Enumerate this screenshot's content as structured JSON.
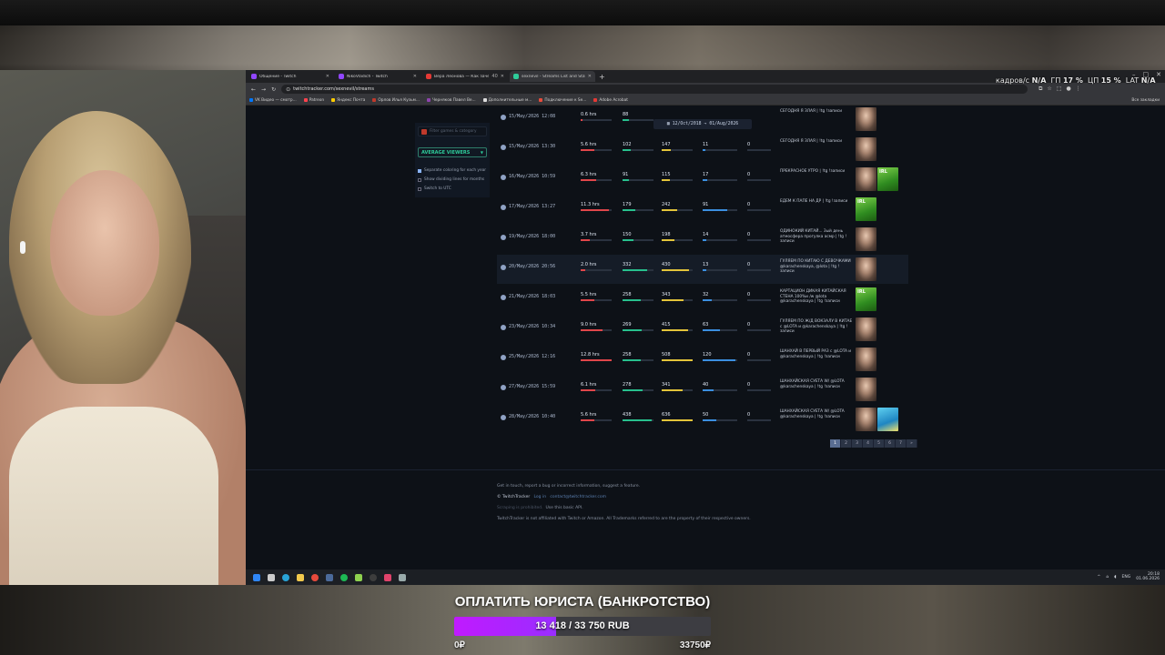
{
  "browser": {
    "tabs": [
      {
        "title": "Общение - Twitch",
        "color": "#9146ff"
      },
      {
        "title": "NikoVladich - Twitch",
        "color": "#9146ff"
      },
      {
        "title": "Вера Леонова — Как зачем?",
        "color": "#e53935"
      },
      {
        "title": "sexnevil - Streams List and Stat",
        "color": "#2ecc9a"
      }
    ],
    "tab_count_badge": "40",
    "url": "twitchtracker.com/sexnevil/streams",
    "bookmarks": [
      {
        "label": "VK Видео — смотр...",
        "color": "#0077ff"
      },
      {
        "label": "Patreon",
        "color": "#ff424d"
      },
      {
        "label": "Яндекс Почта",
        "color": "#ffcc00"
      },
      {
        "label": "Орлов Илья Кузьм...",
        "color": "#c0392b"
      },
      {
        "label": "Черняков Павел Ве...",
        "color": "#8e44ad"
      },
      {
        "label": "Дополнительные м...",
        "color": "#dddddd"
      },
      {
        "label": "Подключение к Se...",
        "color": "#e74c3c"
      },
      {
        "label": "Adobe Acrobat",
        "color": "#e53935"
      }
    ],
    "bookmarks_right": "Все закладки"
  },
  "sidebar": {
    "search_placeholder": "Filter games & category",
    "metric_select": "AVERAGE VIEWERS",
    "options": [
      {
        "label": "Separate coloring for each year",
        "checked": true
      },
      {
        "label": "Show dividing lines for months",
        "checked": false
      },
      {
        "label": "Switch to UTC",
        "checked": false
      }
    ]
  },
  "date_range": {
    "from": "12/Oct/2018",
    "arrow": "→",
    "to": "01/Aug/2026"
  },
  "streams": [
    {
      "date": "15/May/2026 12:08",
      "duration": "0.6 hrs",
      "avg": "88",
      "max": "",
      "followers": "",
      "views": "",
      "title": "СЕГОДНЯ Я ЗЛАЯ | !tg !записи",
      "thumbs": [
        "person"
      ],
      "dur_frac": 0.05,
      "avg_frac": 0.2,
      "max_frac": 0,
      "fol_frac": 0
    },
    {
      "date": "15/May/2026 13:30",
      "duration": "5.6 hrs",
      "avg": "102",
      "max": "147",
      "followers": "11",
      "views": "0",
      "title": "СЕГОДНЯ Я ЗЛАЯ | !tg !записи",
      "thumbs": [
        "person"
      ],
      "dur_frac": 0.45,
      "avg_frac": 0.25,
      "max_frac": 0.3,
      "fol_frac": 0.08
    },
    {
      "date": "16/May/2026 10:59",
      "duration": "6.3 hrs",
      "avg": "91",
      "max": "115",
      "followers": "17",
      "views": "0",
      "title": "ПРЕКРАСНОЕ УТРО | !tg !записи",
      "thumbs": [
        "person",
        "grass"
      ],
      "dur_frac": 0.5,
      "avg_frac": 0.22,
      "max_frac": 0.25,
      "fol_frac": 0.12
    },
    {
      "date": "17/May/2026 13:27",
      "duration": "11.3 hrs",
      "avg": "179",
      "max": "242",
      "followers": "91",
      "views": "0",
      "title": "ЕДЕМ К ПАПЕ НА ДР | !tg !записи",
      "thumbs": [
        "grass"
      ],
      "dur_frac": 0.9,
      "avg_frac": 0.42,
      "max_frac": 0.5,
      "fol_frac": 0.7
    },
    {
      "date": "19/May/2026 18:00",
      "duration": "3.7 hrs",
      "avg": "150",
      "max": "198",
      "followers": "14",
      "views": "0",
      "title": "ОДИНОКИЙ КИТАЙ... 3ый день атмосфера прогулка асмр | !tg !записи",
      "thumbs": [
        "person"
      ],
      "dur_frac": 0.3,
      "avg_frac": 0.35,
      "max_frac": 0.42,
      "fol_frac": 0.1
    },
    {
      "date": "20/May/2026 20:56",
      "duration": "2.0 hrs",
      "avg": "332",
      "max": "430",
      "followers": "13",
      "views": "0",
      "title": "ГУЛЯЕМ ПО КИТАЮ С ДЕВОЧКАМИ @karachenskaya, @lota | !tg !записи",
      "thumbs": [
        "person"
      ],
      "dur_frac": 0.16,
      "avg_frac": 0.78,
      "max_frac": 0.88,
      "fol_frac": 0.1
    },
    {
      "date": "21/May/2026 18:03",
      "duration": "5.5 hrs",
      "avg": "258",
      "max": "343",
      "followers": "32",
      "views": "0",
      "title": "КАРТАЦИОН ДИКАЯ КИТАЙСКАЯ СТЕНА 100%и /w @lota @karachenskaya | !tg !записи",
      "thumbs": [
        "grass"
      ],
      "dur_frac": 0.44,
      "avg_frac": 0.6,
      "max_frac": 0.7,
      "fol_frac": 0.25
    },
    {
      "date": "23/May/2026 10:34",
      "duration": "9.0 hrs",
      "avg": "269",
      "max": "415",
      "followers": "63",
      "views": "0",
      "title": "ГУЛЯЕМ ПО Ж/Д ВОКЗАЛУ В КИТАЕ c @LOTA и @karachenskaya | !tg !записи",
      "thumbs": [
        "person"
      ],
      "dur_frac": 0.72,
      "avg_frac": 0.62,
      "max_frac": 0.85,
      "fol_frac": 0.5
    },
    {
      "date": "25/May/2026 12:16",
      "duration": "12.8 hrs",
      "avg": "258",
      "max": "508",
      "followers": "120",
      "views": "0",
      "title": "ШАНХАЙ В ПЕРВЫЙ РАЗ с @LOTA и @karachenskaya | !tg !записи",
      "thumbs": [
        "person"
      ],
      "dur_frac": 1.0,
      "avg_frac": 0.6,
      "max_frac": 1.0,
      "fol_frac": 0.95
    },
    {
      "date": "27/May/2026 15:59",
      "duration": "6.1 hrs",
      "avg": "278",
      "max": "341",
      "followers": "40",
      "views": "0",
      "title": "ШАНХАЙСКАЯ СУЕТА W/ @LOTA @karachenskaya | !tg !записи",
      "thumbs": [
        "person"
      ],
      "dur_frac": 0.48,
      "avg_frac": 0.64,
      "max_frac": 0.68,
      "fol_frac": 0.32
    },
    {
      "date": "28/May/2026 10:40",
      "duration": "5.6 hrs",
      "avg": "438",
      "max": "636",
      "followers": "50",
      "views": "0",
      "title": "ШАНХАЙСКАЯ СУЕТА W/ @LOTA @karachenskaya | !tg !записи",
      "thumbs": [
        "person",
        "chill"
      ],
      "dur_frac": 0.45,
      "avg_frac": 0.95,
      "max_frac": 1.0,
      "fol_frac": 0.4
    }
  ],
  "pager": [
    "1",
    "2",
    "3",
    "4",
    "5",
    "6",
    "7",
    "»"
  ],
  "footer": {
    "line1": "Get in touch, report a bug or incorrect information, suggest a feature.",
    "brand": "© TwitchTracker",
    "login": "Log in",
    "email": "contact@twitchtracker.com",
    "api_note": "Scraping is prohibited.",
    "api_link": "Use this basic API.",
    "disclaimer": "TwitchTracker is not affiliated with Twitch or Amazon. All Trademarks referred to are the property of their respective owners."
  },
  "taskbar": {
    "lang": "ENG",
    "time": "20:18",
    "date": "01.06.2026"
  },
  "obs_stats": {
    "fps_label": "кадров/с",
    "fps": "N/A",
    "gpu_label": "ГП",
    "gpu": "17 %",
    "cpu_label": "ЦП",
    "cpu": "15 %",
    "lat_label": "LAT",
    "lat": "N/A"
  },
  "goal": {
    "title": "ОПЛАТИТЬ ЮРИСТА (БАНКРОТСТВО)",
    "progress_text": "13 418 / 33 750 RUB",
    "raised": 13418,
    "target": 33750,
    "min_label": "0₽",
    "max_label": "33750₽",
    "fill_color": "#c01aff"
  }
}
